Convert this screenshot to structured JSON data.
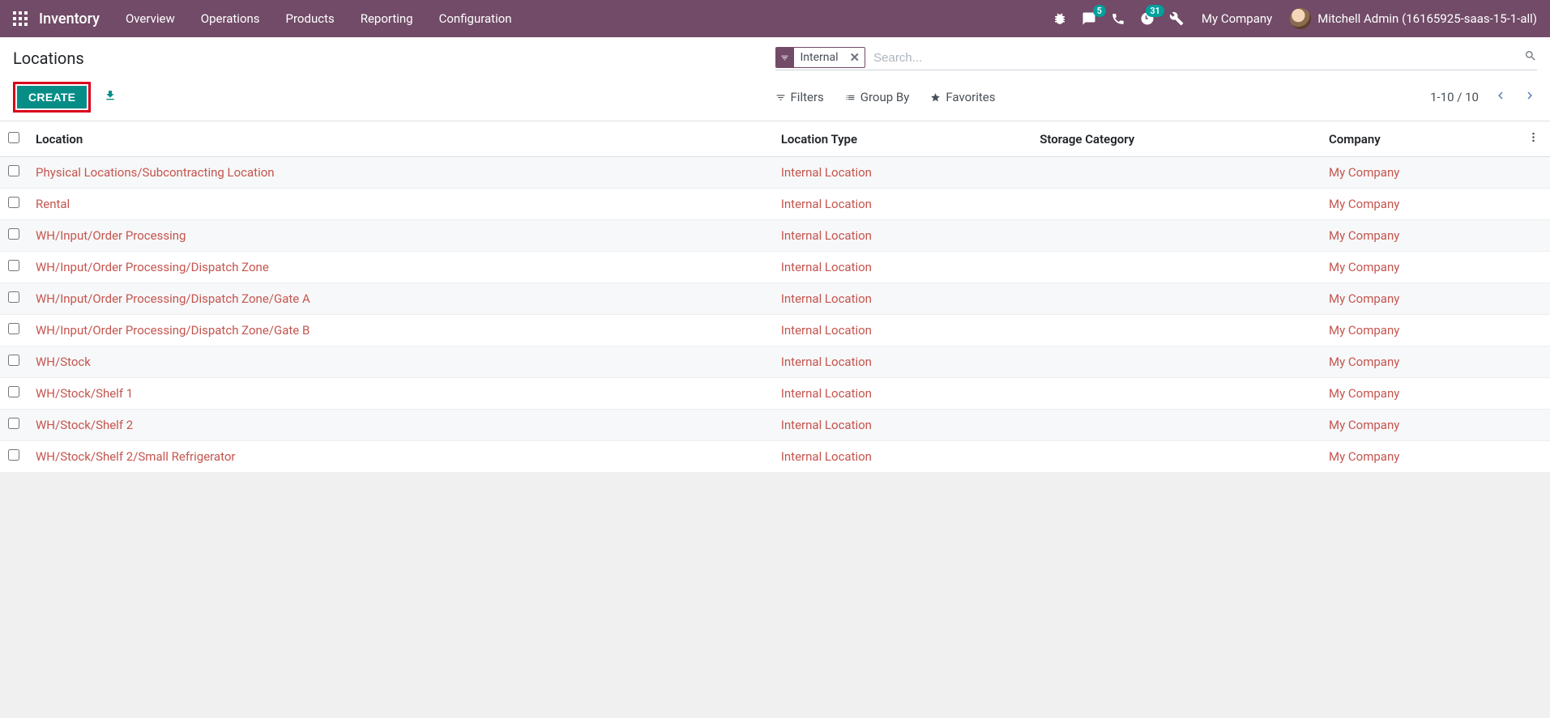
{
  "topnav": {
    "brand": "Inventory",
    "menu": [
      "Overview",
      "Operations",
      "Products",
      "Reporting",
      "Configuration"
    ],
    "messages_badge": "5",
    "activities_badge": "31",
    "company": "My Company",
    "user": "Mitchell Admin (16165925-saas-15-1-all)"
  },
  "cp": {
    "breadcrumb": "Locations",
    "facet_label": "Internal",
    "search_placeholder": "Search...",
    "create": "CREATE",
    "filters": "Filters",
    "groupby": "Group By",
    "favorites": "Favorites",
    "pager": "1-10 / 10"
  },
  "table": {
    "headers": {
      "location": "Location",
      "type": "Location Type",
      "category": "Storage Category",
      "company": "Company"
    },
    "rows": [
      {
        "location": "Physical Locations/Subcontracting Location",
        "type": "Internal Location",
        "category": "",
        "company": "My Company"
      },
      {
        "location": "Rental",
        "type": "Internal Location",
        "category": "",
        "company": "My Company"
      },
      {
        "location": "WH/Input/Order Processing",
        "type": "Internal Location",
        "category": "",
        "company": "My Company"
      },
      {
        "location": "WH/Input/Order Processing/Dispatch Zone",
        "type": "Internal Location",
        "category": "",
        "company": "My Company"
      },
      {
        "location": "WH/Input/Order Processing/Dispatch Zone/Gate A",
        "type": "Internal Location",
        "category": "",
        "company": "My Company"
      },
      {
        "location": "WH/Input/Order Processing/Dispatch Zone/Gate B",
        "type": "Internal Location",
        "category": "",
        "company": "My Company"
      },
      {
        "location": "WH/Stock",
        "type": "Internal Location",
        "category": "",
        "company": "My Company"
      },
      {
        "location": "WH/Stock/Shelf 1",
        "type": "Internal Location",
        "category": "",
        "company": "My Company"
      },
      {
        "location": "WH/Stock/Shelf 2",
        "type": "Internal Location",
        "category": "",
        "company": "My Company"
      },
      {
        "location": "WH/Stock/Shelf 2/Small Refrigerator",
        "type": "Internal Location",
        "category": "",
        "company": "My Company"
      }
    ]
  }
}
